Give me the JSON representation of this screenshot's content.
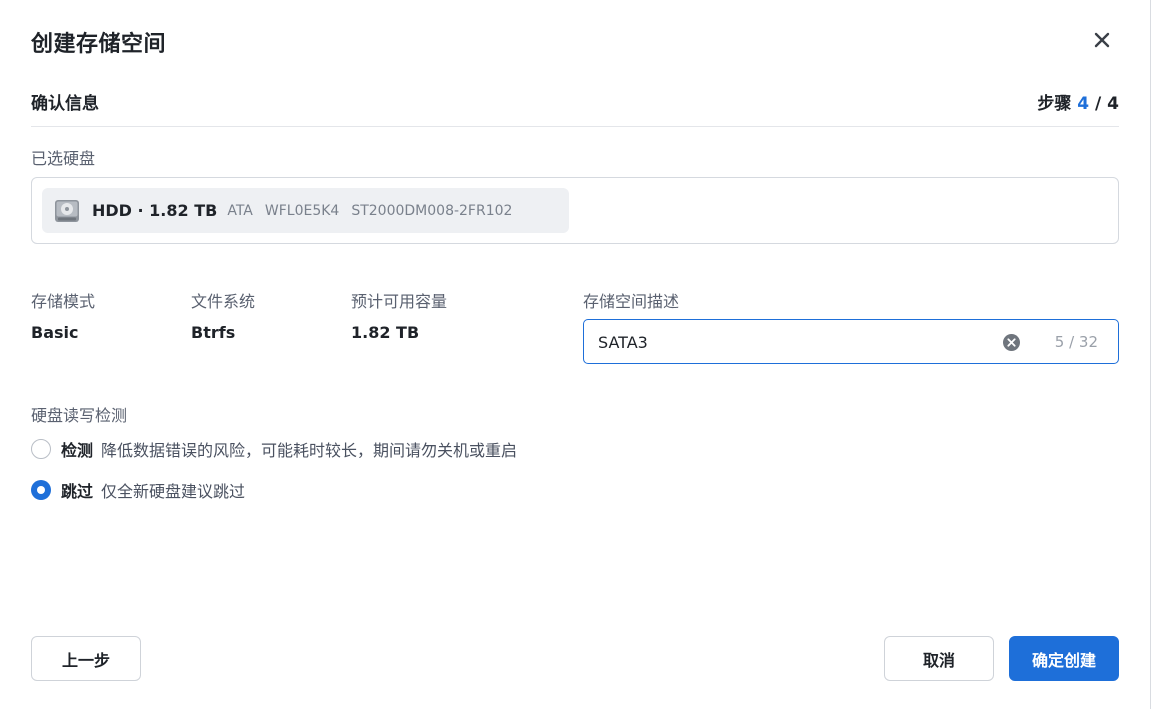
{
  "dialog": {
    "title": "创建存储空间",
    "close_icon": "close-icon"
  },
  "step": {
    "title": "确认信息",
    "prefix": "步骤",
    "current": "4",
    "separator": "/",
    "total": "4"
  },
  "disks": {
    "label": "已选硬盘",
    "items": [
      {
        "icon": "hard-disk-icon",
        "name": "HDD · 1.82 TB",
        "vendor": "ATA",
        "serial": "WFL0E5K4",
        "model": "ST2000DM008-2FR102"
      }
    ]
  },
  "summary": {
    "mode_label": "存储模式",
    "mode_value": "Basic",
    "fs_label": "文件系统",
    "fs_value": "Btrfs",
    "capacity_label": "预计可用容量",
    "capacity_value": "1.82 TB",
    "description_label": "存储空间描述",
    "description_value": "SATA3",
    "description_counter": "5 / 32"
  },
  "check": {
    "label": "硬盘读写检测",
    "options": [
      {
        "title": "检测",
        "desc": "降低数据错误的风险，可能耗时较长，期间请勿关机或重启",
        "selected": false
      },
      {
        "title": "跳过",
        "desc": "仅全新硬盘建议跳过",
        "selected": true
      }
    ]
  },
  "footer": {
    "prev_label": "上一步",
    "cancel_label": "取消",
    "confirm_label": "确定创建"
  },
  "colors": {
    "accent": "#1e6fd9",
    "text": "#1f2329",
    "muted": "#5a6170"
  }
}
